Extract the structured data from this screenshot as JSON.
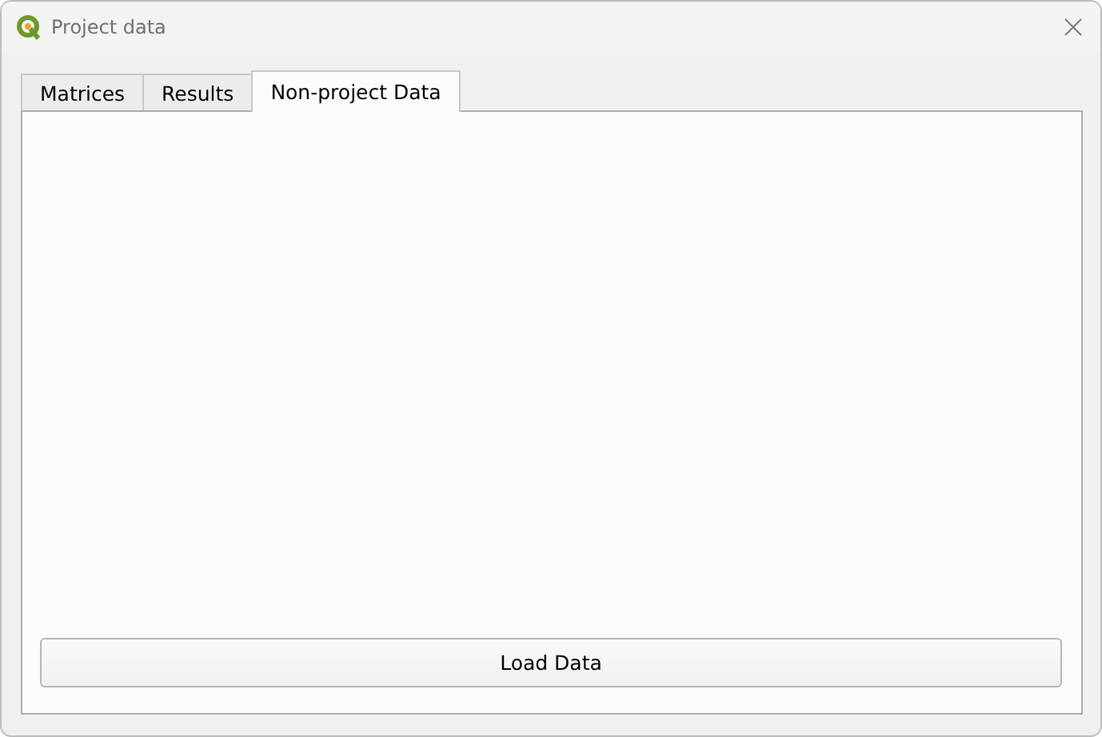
{
  "window": {
    "title": "Project data"
  },
  "tabs": [
    {
      "label": "Matrices",
      "selected": false
    },
    {
      "label": "Results",
      "selected": false
    },
    {
      "label": "Non-project Data",
      "selected": true
    }
  ],
  "buttons": [
    "Load Data"
  ]
}
